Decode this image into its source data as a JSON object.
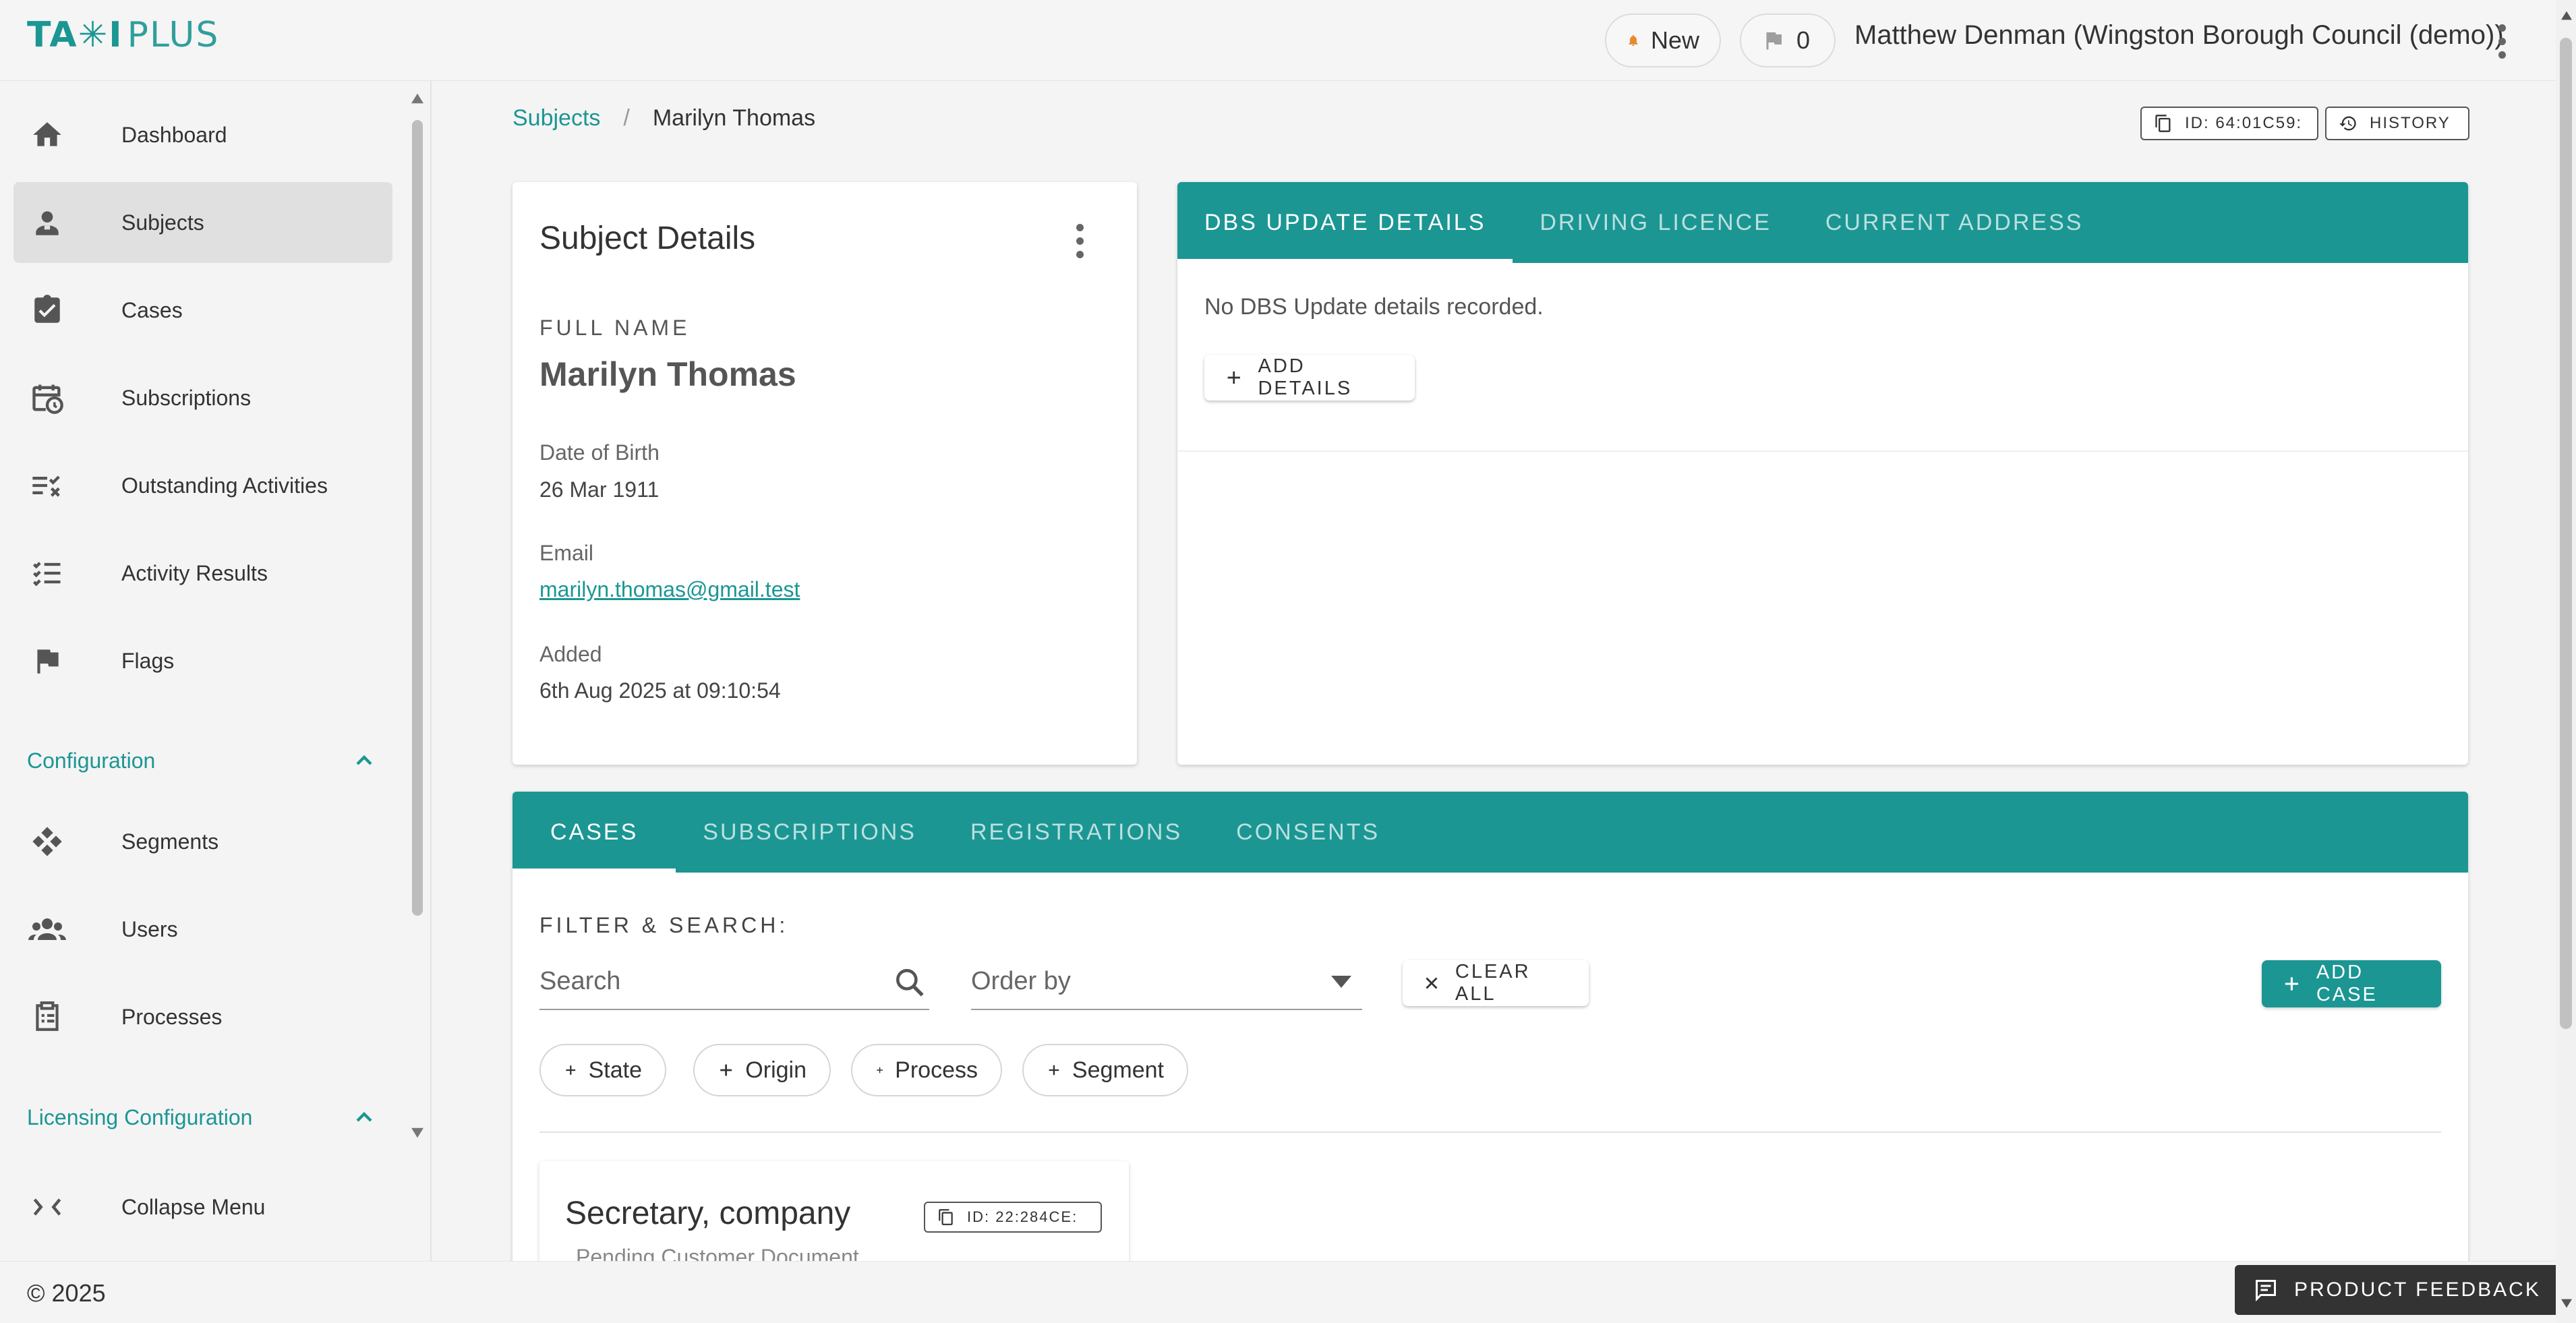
{
  "brand": {
    "logo_bold": "TA✳I",
    "logo_light": "PLUS",
    "accent": "#1b9693"
  },
  "header": {
    "notifications_label": "New",
    "flags_count": "0",
    "user": "Matthew Denman (Wingston Borough Council (demo))"
  },
  "sidebar": {
    "items": [
      {
        "label": "Dashboard",
        "icon": "home-icon"
      },
      {
        "label": "Subjects",
        "icon": "person-badge-icon",
        "active": true
      },
      {
        "label": "Cases",
        "icon": "clipboard-check-icon"
      },
      {
        "label": "Subscriptions",
        "icon": "calendar-clock-icon"
      },
      {
        "label": "Outstanding Activities",
        "icon": "checklist-x-icon"
      },
      {
        "label": "Activity Results",
        "icon": "checklist-icon"
      },
      {
        "label": "Flags",
        "icon": "flag-icon"
      }
    ],
    "config_heading": "Configuration",
    "config_items": [
      {
        "label": "Segments",
        "icon": "segments-icon"
      },
      {
        "label": "Users",
        "icon": "users-icon"
      },
      {
        "label": "Processes",
        "icon": "process-clipboard-icon"
      }
    ],
    "licensing_heading": "Licensing Configuration",
    "collapse_label": "Collapse Menu"
  },
  "breadcrumb": {
    "root": "Subjects",
    "separator": "/",
    "current": "Marilyn Thomas"
  },
  "top_actions": {
    "id_label": "ID: 64:01C59:",
    "history_label": "HISTORY"
  },
  "subject_card": {
    "title": "Subject Details",
    "full_name_label": "FULL NAME",
    "full_name": "Marilyn Thomas",
    "dob_label": "Date of Birth",
    "dob": "26 Mar 1911",
    "email_label": "Email",
    "email": "marilyn.thomas@gmail.test",
    "added_label": "Added",
    "added": "6th Aug 2025 at 09:10:54"
  },
  "details_card": {
    "tabs": [
      "DBS UPDATE DETAILS",
      "DRIVING LICENCE",
      "CURRENT ADDRESS"
    ],
    "empty_text": "No DBS Update details recorded.",
    "add_label": "ADD DETAILS"
  },
  "cases_card": {
    "tabs": [
      "CASES",
      "SUBSCRIPTIONS",
      "REGISTRATIONS",
      "CONSENTS"
    ],
    "filter_heading": "FILTER & SEARCH:",
    "search_placeholder": "Search",
    "order_placeholder": "Order by",
    "clear_label": "CLEAR ALL",
    "add_case_label": "ADD CASE",
    "chips": [
      "State",
      "Origin",
      "Process",
      "Segment"
    ],
    "case_title": "Secretary, company",
    "case_id": "ID: 22:284CE:",
    "case_subtitle": "Pending Customer Document"
  },
  "footer": {
    "copyright": "© 2025",
    "feedback_label": "PRODUCT FEEDBACK"
  }
}
